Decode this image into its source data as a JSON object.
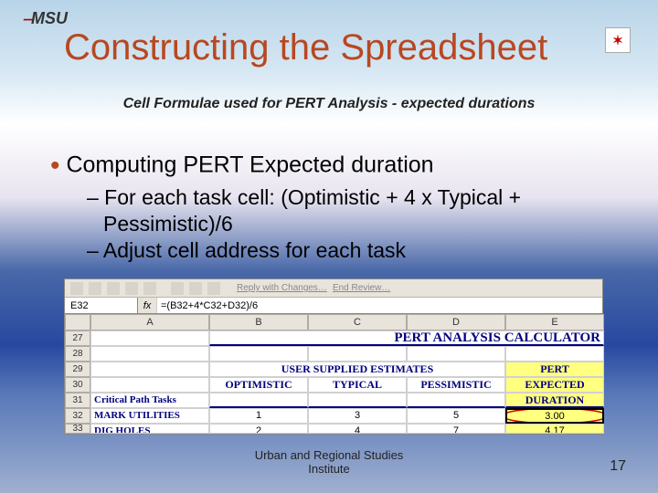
{
  "logo": {
    "text": "MSU"
  },
  "title": "Constructing the Spreadsheet",
  "subtitle": "Cell Formulae used for PERT Analysis - expected durations",
  "bullet": "Computing PERT Expected duration",
  "sub1": "– For each task cell: (Optimistic + 4 x Typical + Pessimistic)/6",
  "sub2": "– Adjust cell address for each task",
  "toolbar": {
    "reply": "Reply with Changes…",
    "end": "End Review…"
  },
  "sheet": {
    "namebox": "E32",
    "fx": "fx",
    "formula": "=(B32+4*C32+D32)/6",
    "cols": {
      "a": "A",
      "b": "B",
      "c": "C",
      "d": "D",
      "e": "E"
    },
    "rows": {
      "r27": "27",
      "r28": "28",
      "r29": "29",
      "r30": "30",
      "r31": "31",
      "r32": "32",
      "r33": "33"
    },
    "pert_title": "PERT ANALYSIS CALCULATOR",
    "user_header": "USER SUPPLIED ESTIMATES",
    "col_opt": "OPTIMISTIC",
    "col_typ": "TYPICAL",
    "col_pes": "PESSIMISTIC",
    "pert_col1": "PERT",
    "pert_col2": "EXPECTED",
    "pert_col3": "DURATION",
    "cpt": "Critical Path Tasks",
    "task1": "MARK UTILITIES",
    "task2": "DIG HOLES",
    "v": {
      "b32": "1",
      "c32": "3",
      "d32": "5",
      "e32": "3.00",
      "b33": "2",
      "c33": "4",
      "d33": "7",
      "e33": "4.17"
    }
  },
  "footer": {
    "line1": "Urban and Regional Studies",
    "line2": "Institute"
  },
  "page": "17"
}
